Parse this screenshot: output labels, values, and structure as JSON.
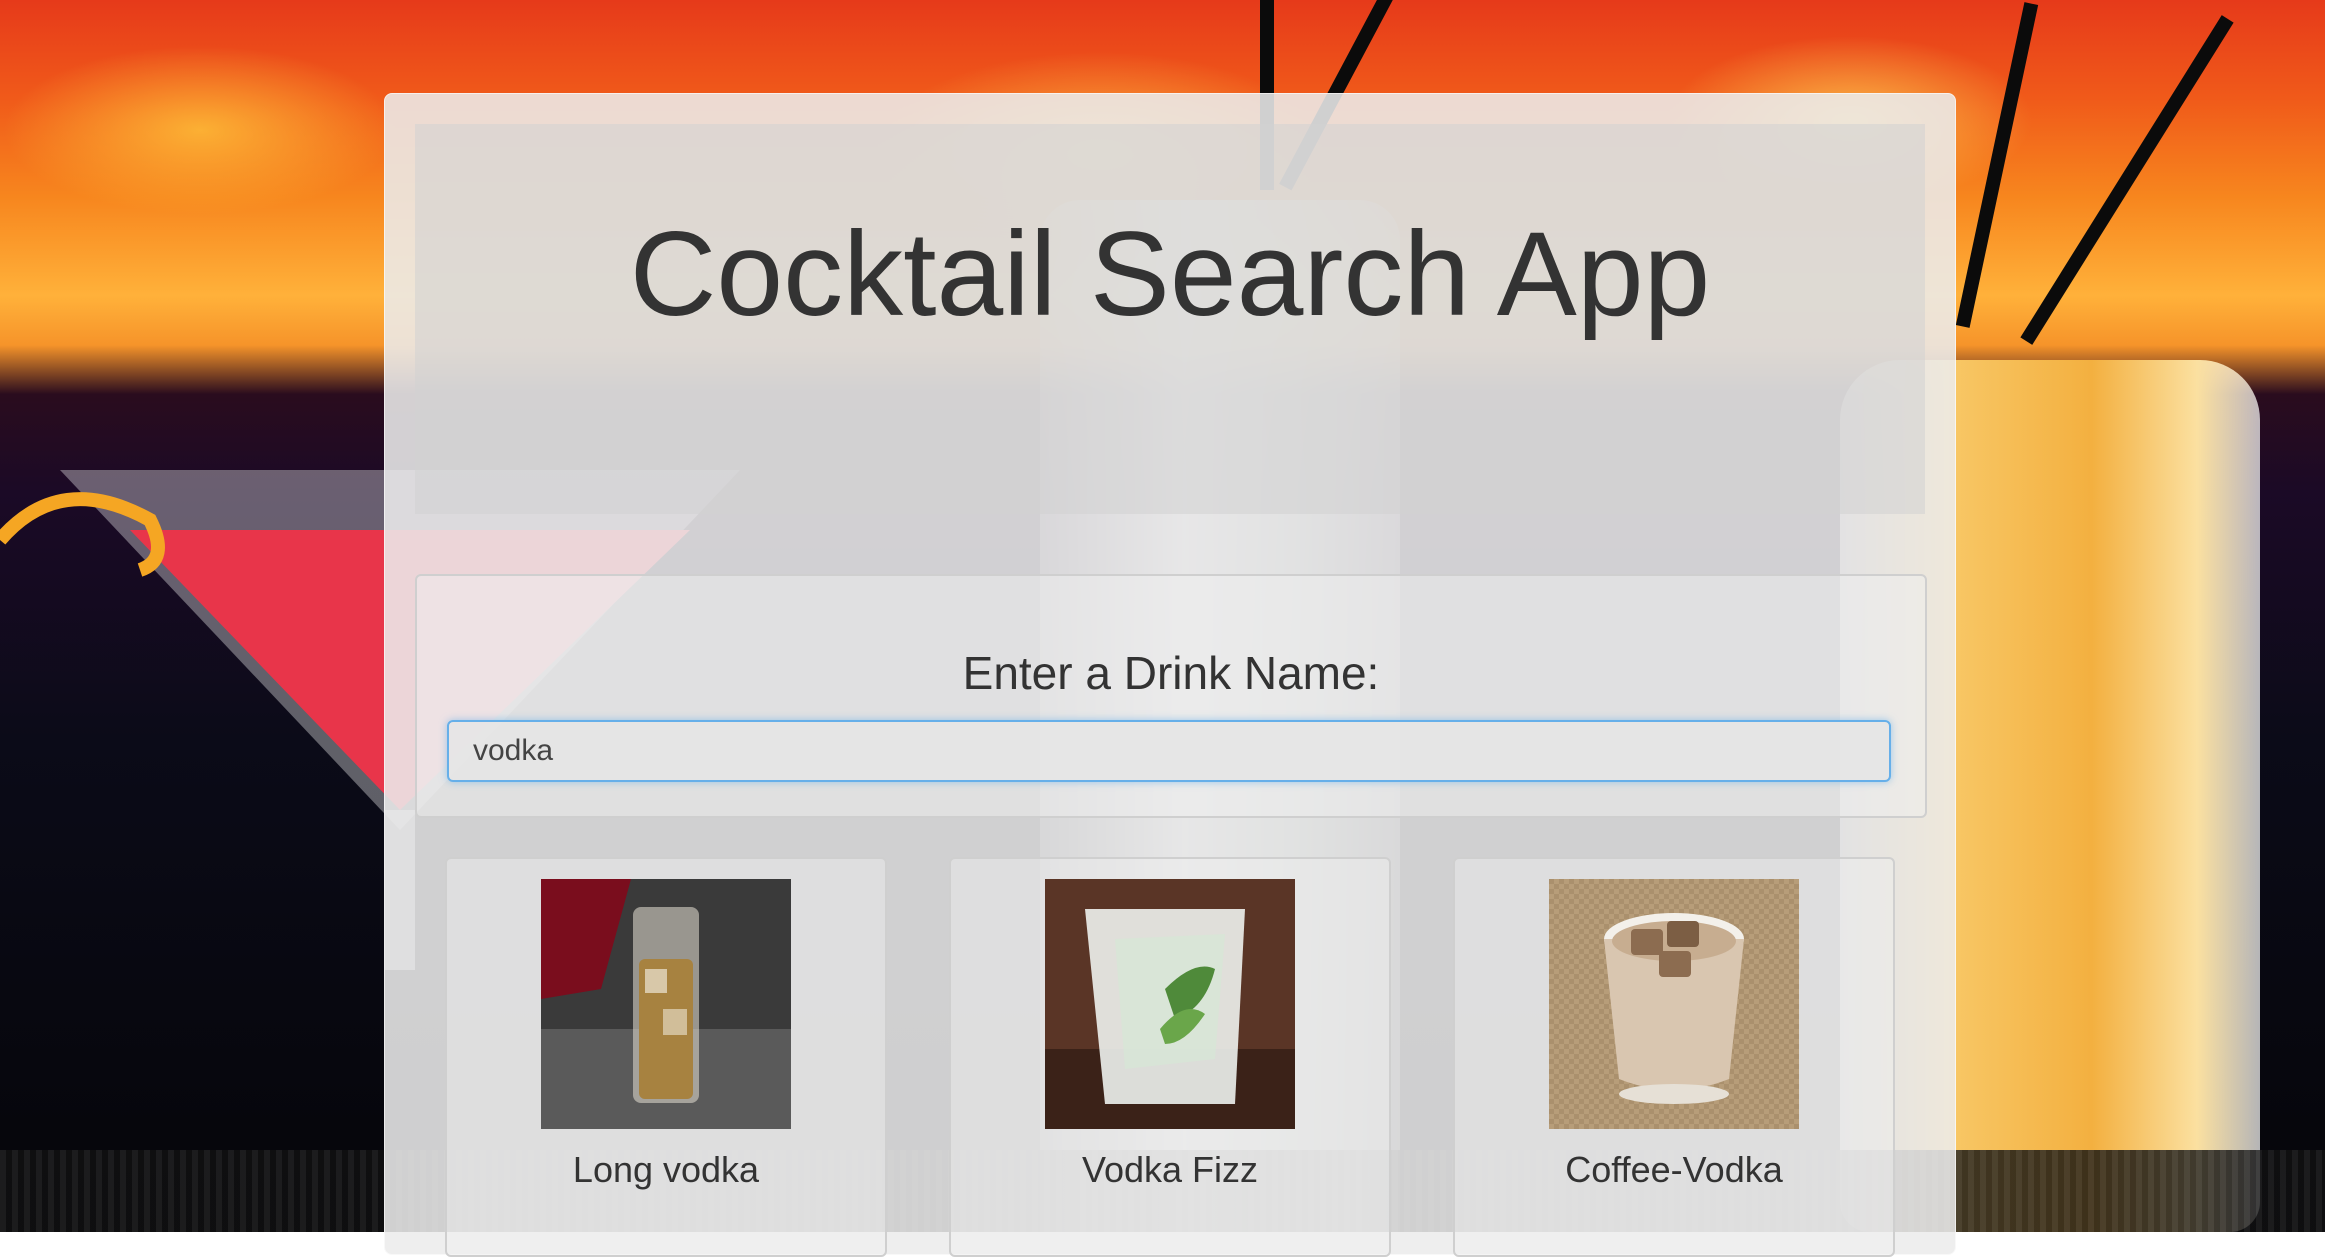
{
  "header": {
    "title": "Cocktail Search App"
  },
  "search": {
    "label": "Enter a Drink Name:",
    "value": "vodka",
    "placeholder": ""
  },
  "results": [
    {
      "name": "Long vodka",
      "image": "long-vodka-drink-image"
    },
    {
      "name": "Vodka Fizz",
      "image": "vodka-fizz-drink-image"
    },
    {
      "name": "Coffee-Vodka",
      "image": "coffee-vodka-drink-image"
    }
  ],
  "colors": {
    "focus_border": "#66afe9",
    "text": "#333333",
    "panel": "#ececec"
  }
}
